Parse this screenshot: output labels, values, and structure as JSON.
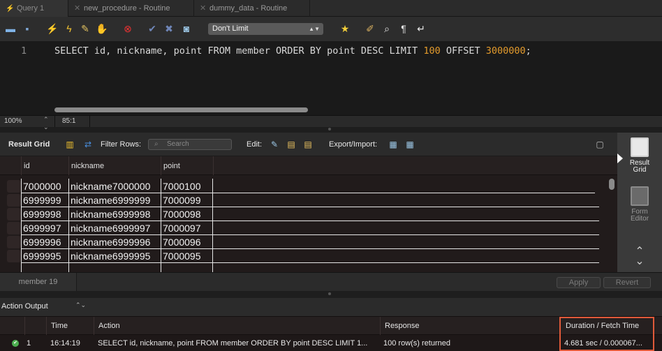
{
  "tabs": [
    {
      "label": "Query 1",
      "active": true
    },
    {
      "label": "new_procedure - Routine",
      "active": false
    },
    {
      "label": "dummy_data - Routine",
      "active": false
    }
  ],
  "toolbar": {
    "limit_value": "Don't Limit",
    "icons": [
      "open-folder-icon",
      "save-icon",
      "execute-icon",
      "execute-current-icon",
      "explain-icon",
      "stop-icon",
      "toggle-error-icon",
      "commit-icon",
      "rollback-icon",
      "autocommit-icon",
      "beautify-icon",
      "find-icon",
      "invisible-chars-icon",
      "wrap-icon"
    ]
  },
  "editor": {
    "line_number": "1",
    "sql_kw1": "SELECT id, nickname, point FROM member ORDER BY point DESC LIMIT ",
    "sql_num1": "100",
    "sql_kw2": " OFFSET ",
    "sql_num2": "3000000",
    "sql_end": ";"
  },
  "editor_status": {
    "zoom": "100%",
    "cursor": "85:1"
  },
  "result_toolbar": {
    "title": "Result Grid",
    "filter_label": "Filter Rows:",
    "search_placeholder": "Search",
    "edit_label": "Edit:",
    "export_label": "Export/Import:"
  },
  "grid": {
    "columns": [
      "id",
      "nickname",
      "point"
    ],
    "rows": [
      [
        "7000000",
        "nickname7000000",
        "7000100"
      ],
      [
        "6999999",
        "nickname6999999",
        "7000099"
      ],
      [
        "6999998",
        "nickname6999998",
        "7000098"
      ],
      [
        "6999997",
        "nickname6999997",
        "7000097"
      ],
      [
        "6999996",
        "nickname6999996",
        "7000096"
      ],
      [
        "6999995",
        "nickname6999995",
        "7000095"
      ]
    ]
  },
  "side_panel": {
    "result_grid": "Result\nGrid",
    "form_editor": "Form\nEditor"
  },
  "grid_bottom": {
    "tab_label": "member 19",
    "apply": "Apply",
    "revert": "Revert"
  },
  "output": {
    "selector_label": "Action Output",
    "columns": [
      "Time",
      "Action",
      "Response",
      "Duration / Fetch Time"
    ],
    "row": {
      "index": "1",
      "time": "16:14:19",
      "action": "SELECT id, nickname, point FROM member ORDER BY point DESC LIMIT 1...",
      "response": "100 row(s) returned",
      "duration": "4.681 sec / 0.000067..."
    }
  },
  "colors": {
    "accent_highlight": "#e05a3a",
    "number_literal": "#e39b2c",
    "success": "#4caf50"
  }
}
